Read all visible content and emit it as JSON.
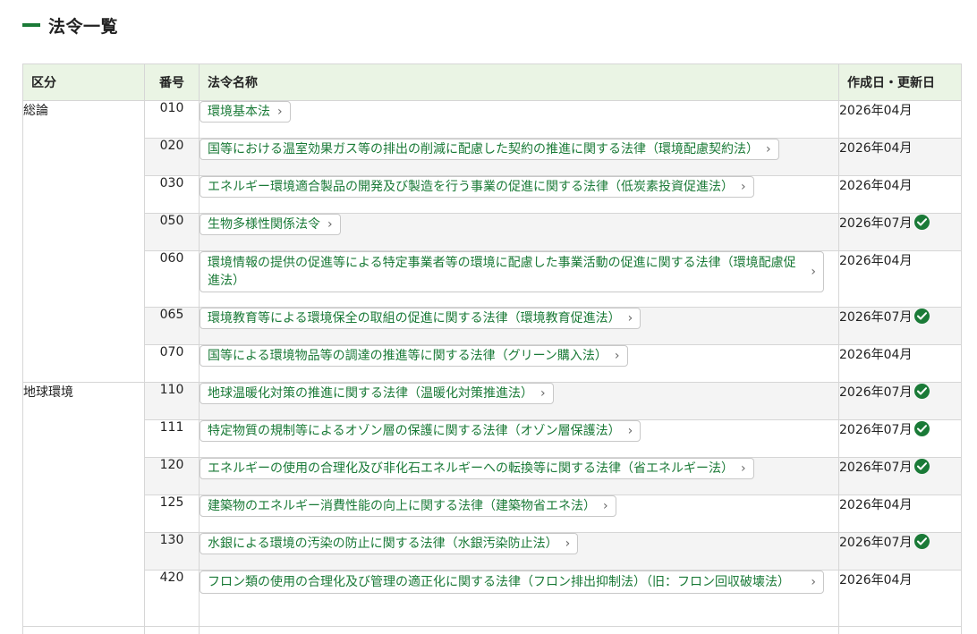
{
  "page": {
    "title": "法令一覧"
  },
  "table": {
    "headers": {
      "kubun": "区分",
      "number": "番号",
      "name": "法令名称",
      "date": "作成日・更新日"
    },
    "groups": [
      {
        "kubun": "総論",
        "rows": [
          {
            "number": "010",
            "name": "環境基本法",
            "date": "2026年04月",
            "updated": false
          },
          {
            "number": "020",
            "name": "国等における温室効果ガス等の排出の削減に配慮した契約の推進に関する法律（環境配慮契約法）",
            "date": "2026年04月",
            "updated": false
          },
          {
            "number": "030",
            "name": "エネルギー環境適合製品の開発及び製造を行う事業の促進に関する法律（低炭素投資促進法）",
            "date": "2026年04月",
            "updated": false
          },
          {
            "number": "050",
            "name": "生物多様性関係法令",
            "date": "2026年07月",
            "updated": true
          },
          {
            "number": "060",
            "name": "環境情報の提供の促進等による特定事業者等の環境に配慮した事業活動の促進に関する法律（環境配慮促進法）",
            "date": "2026年04月",
            "updated": false
          },
          {
            "number": "065",
            "name": "環境教育等による環境保全の取組の促進に関する法律（環境教育促進法）",
            "date": "2026年07月",
            "updated": true
          },
          {
            "number": "070",
            "name": "国等による環境物品等の調達の推進等に関する法律（グリーン購入法）",
            "date": "2026年04月",
            "updated": false
          }
        ]
      },
      {
        "kubun": "地球環境",
        "rows": [
          {
            "number": "110",
            "name": "地球温暖化対策の推進に関する法律（温暖化対策推進法）",
            "date": "2026年07月",
            "updated": true
          },
          {
            "number": "111",
            "name": "特定物質の規制等によるオゾン層の保護に関する法律（オゾン層保護法）",
            "date": "2026年07月",
            "updated": true
          },
          {
            "number": "120",
            "name": "エネルギーの使用の合理化及び非化石エネルギーへの転換等に関する法律（省エネルギー法）",
            "date": "2026年07月",
            "updated": true
          },
          {
            "number": "125",
            "name": "建築物のエネルギー消費性能の向上に関する法律（建築物省エネ法）",
            "date": "2026年04月",
            "updated": false
          },
          {
            "number": "130",
            "name": "水銀による環境の汚染の防止に関する法律（水銀汚染防止法）",
            "date": "2026年07月",
            "updated": true
          },
          {
            "number": "420",
            "name": "フロン類の使用の合理化及び管理の適正化に関する法律（フロン排出抑制法）（旧：フロン回収破壊法）",
            "date": "2026年04月",
            "updated": false
          }
        ]
      }
    ]
  },
  "icons": {
    "link_chevron": "chevron-right-icon",
    "updated_badge": "check-circle-icon"
  },
  "colors": {
    "accent": "#1a7a37",
    "header_bg": "#eaf4e4",
    "row_alt_bg": "#f4f4f4"
  }
}
